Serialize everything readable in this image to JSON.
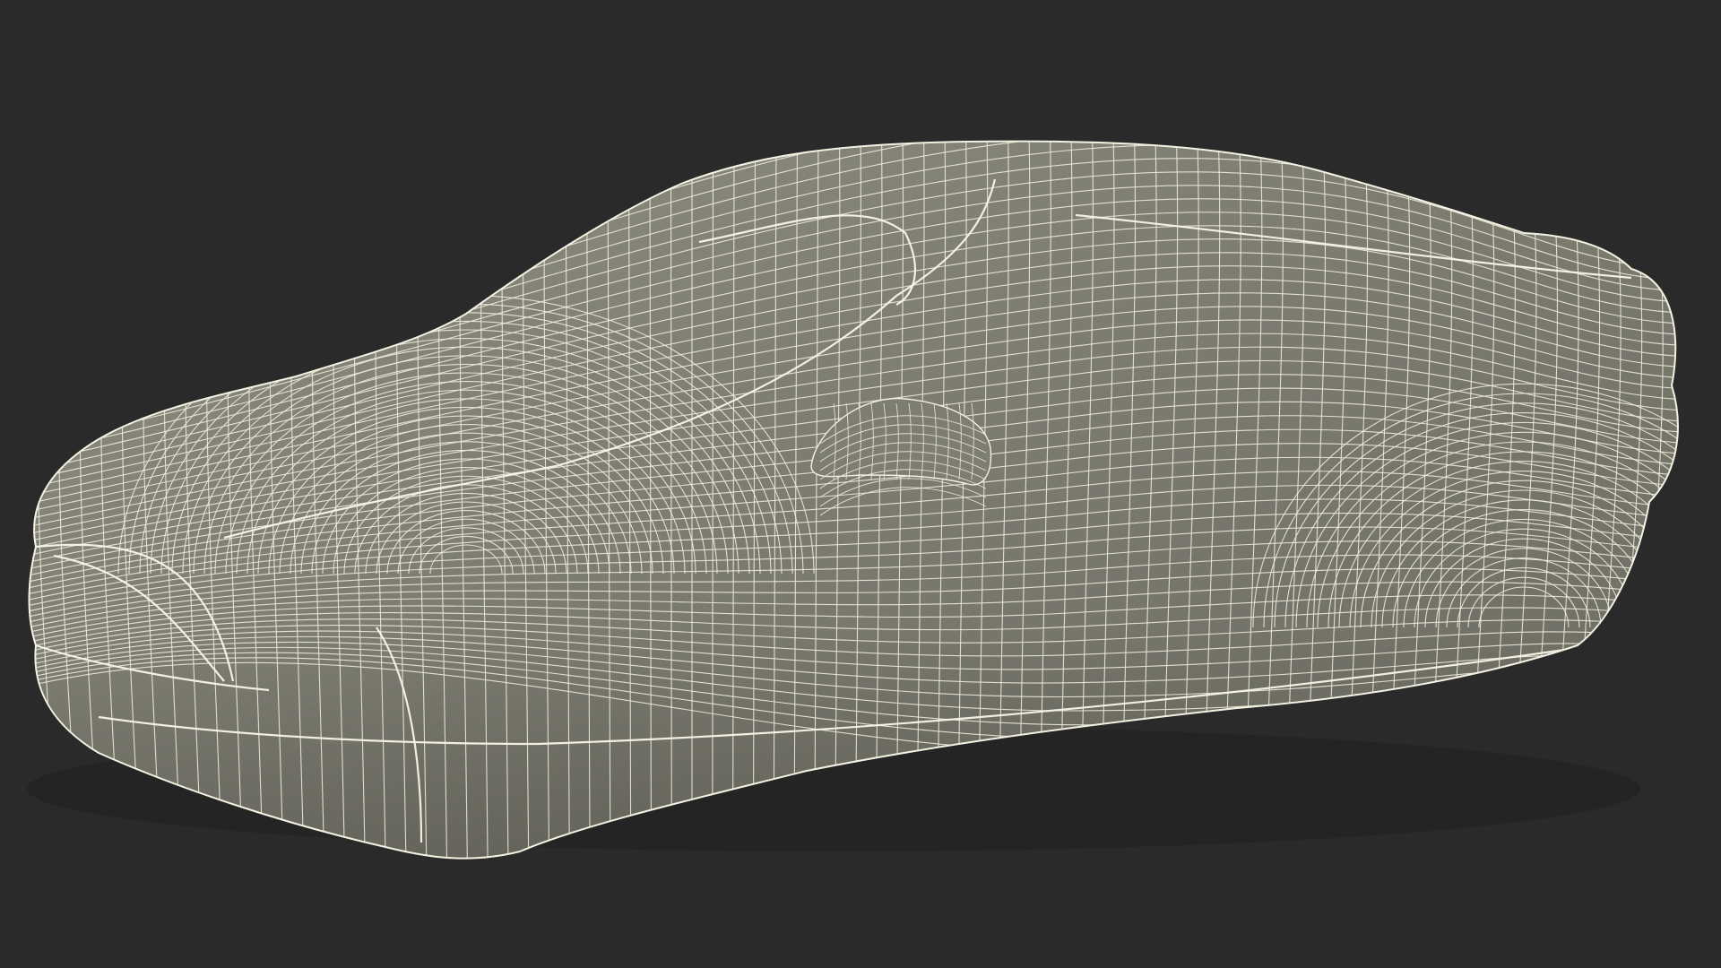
{
  "scene": {
    "subject": "car-cover-wireframe",
    "colors": {
      "background": "#2a2a2a",
      "surface": "#7c7b70",
      "surface_light": "#8a897e",
      "surface_dark": "#5f5e55",
      "wire": "#ecebd9",
      "wire_strong": "#f7f6e8",
      "shadow": "#1f1f1f"
    }
  }
}
